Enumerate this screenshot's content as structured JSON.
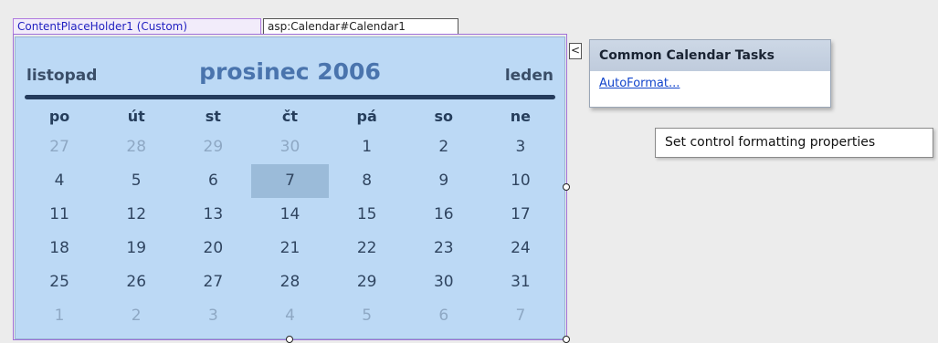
{
  "tags": {
    "content_placeholder": "ContentPlaceHolder1 (Custom)",
    "calendar_control": "asp:Calendar#Calendar1"
  },
  "calendar": {
    "prev_month": "listopad",
    "title": "prosinec 2006",
    "next_month": "leden",
    "days_of_week": [
      "po",
      "út",
      "st",
      "čt",
      "pá",
      "so",
      "ne"
    ],
    "weeks": [
      [
        {
          "d": "27",
          "other": true
        },
        {
          "d": "28",
          "other": true
        },
        {
          "d": "29",
          "other": true
        },
        {
          "d": "30",
          "other": true
        },
        {
          "d": "1"
        },
        {
          "d": "2"
        },
        {
          "d": "3"
        }
      ],
      [
        {
          "d": "4"
        },
        {
          "d": "5"
        },
        {
          "d": "6"
        },
        {
          "d": "7",
          "selected": true
        },
        {
          "d": "8"
        },
        {
          "d": "9"
        },
        {
          "d": "10"
        }
      ],
      [
        {
          "d": "11"
        },
        {
          "d": "12"
        },
        {
          "d": "13"
        },
        {
          "d": "14"
        },
        {
          "d": "15"
        },
        {
          "d": "16"
        },
        {
          "d": "17"
        }
      ],
      [
        {
          "d": "18"
        },
        {
          "d": "19"
        },
        {
          "d": "20"
        },
        {
          "d": "21"
        },
        {
          "d": "22"
        },
        {
          "d": "23"
        },
        {
          "d": "24"
        }
      ],
      [
        {
          "d": "25"
        },
        {
          "d": "26"
        },
        {
          "d": "27"
        },
        {
          "d": "28"
        },
        {
          "d": "29"
        },
        {
          "d": "30"
        },
        {
          "d": "31"
        }
      ],
      [
        {
          "d": "1",
          "other": true
        },
        {
          "d": "2",
          "other": true
        },
        {
          "d": "3",
          "other": true
        },
        {
          "d": "4",
          "other": true
        },
        {
          "d": "5",
          "other": true
        },
        {
          "d": "6",
          "other": true
        },
        {
          "d": "7",
          "other": true
        }
      ]
    ]
  },
  "smart_tag": {
    "button_glyph": "<",
    "panel_title": "Common Calendar Tasks",
    "autoformat_link": "AutoFormat...",
    "tooltip": "Set control formatting properties"
  },
  "colors": {
    "calendar_bg": "#bcd9f5",
    "title": "#4a74ad",
    "rule": "#243b5c",
    "selected_day": "#9bbbd9",
    "other_month_day": "#8ea8c4",
    "placeholder_border": "#a070d8"
  }
}
